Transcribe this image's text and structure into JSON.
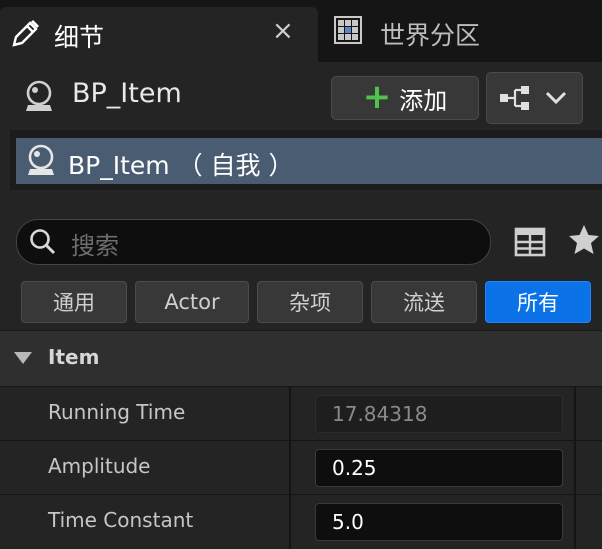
{
  "tabs": [
    {
      "label": "细节",
      "close": "×"
    },
    {
      "label": "世界分区"
    }
  ],
  "actor": {
    "name": "BP_Item"
  },
  "toolbar": {
    "add_label": "添加"
  },
  "components": [
    {
      "label": "BP_Item （ 自我 ）"
    }
  ],
  "search": {
    "placeholder": "搜索"
  },
  "filters": [
    {
      "label": "通用",
      "active": false
    },
    {
      "label": "Actor",
      "active": false
    },
    {
      "label": "杂项",
      "active": false
    },
    {
      "label": "流送",
      "active": false
    },
    {
      "label": "所有",
      "active": true
    }
  ],
  "category": {
    "label": "Item"
  },
  "properties": [
    {
      "name": "Running Time",
      "value": "17.84318",
      "editable": false
    },
    {
      "name": "Amplitude",
      "value": "0.25",
      "editable": true
    },
    {
      "name": "Time Constant",
      "value": "5.0",
      "editable": true
    }
  ],
  "colors": {
    "accent": "#0b72e7",
    "selection": "#4a5c72",
    "add_plus": "#4fc34f"
  },
  "icons": [
    "pencil-icon",
    "close-icon",
    "world-partition-icon",
    "actor-sphere-icon",
    "plus-icon",
    "blueprint-icon",
    "chevron-down-icon",
    "search-icon",
    "table-view-icon",
    "star-icon",
    "collapse-triangle-icon"
  ]
}
